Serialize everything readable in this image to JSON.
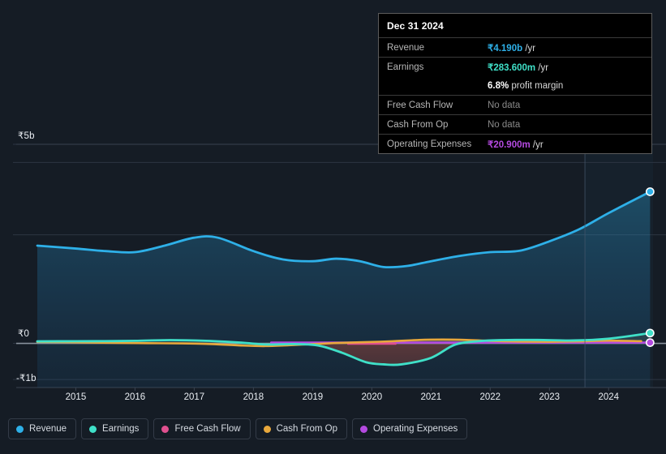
{
  "chart_data": {
    "type": "area",
    "title": "",
    "xlabel": "",
    "ylabel": "",
    "currency": "₹",
    "ylim": [
      -1000000000,
      5000000000
    ],
    "y_ticks": [
      {
        "label": "₹5b",
        "value": 5000000000
      },
      {
        "label": "₹0",
        "value": 0
      },
      {
        "label": "-₹1b",
        "value": -1000000000
      }
    ],
    "x_ticks": [
      "2015",
      "2016",
      "2017",
      "2018",
      "2019",
      "2020",
      "2021",
      "2022",
      "2023",
      "2024"
    ],
    "grid": true,
    "legend_position": "bottom",
    "forecast_divider_year": 2023.6,
    "series": [
      {
        "name": "Revenue",
        "color": "#2eb0e8",
        "x": [
          2014.35,
          2015.0,
          2015.5,
          2016.0,
          2016.5,
          2017.0,
          2017.4,
          2018.0,
          2018.5,
          2019.0,
          2019.4,
          2019.8,
          2020.2,
          2020.6,
          2021.0,
          2021.5,
          2022.0,
          2022.5,
          2023.0,
          2023.5,
          2024.0,
          2024.7
        ],
        "values": [
          2.7,
          2.62,
          2.55,
          2.52,
          2.7,
          2.92,
          2.92,
          2.55,
          2.32,
          2.27,
          2.34,
          2.27,
          2.11,
          2.14,
          2.27,
          2.42,
          2.52,
          2.56,
          2.82,
          3.15,
          3.6,
          4.19
        ],
        "units": "b"
      },
      {
        "name": "Earnings",
        "color": "#3fe0c8",
        "x": [
          2014.35,
          2015.0,
          2015.5,
          2016.0,
          2016.6,
          2017.2,
          2017.8,
          2018.2,
          2018.7,
          2019.1,
          2019.5,
          2019.9,
          2020.2,
          2020.5,
          2021.0,
          2021.4,
          2021.8,
          2022.2,
          2022.8,
          2023.4,
          2024.0,
          2024.7
        ],
        "values": [
          0.055,
          0.06,
          0.062,
          0.07,
          0.09,
          0.07,
          0.02,
          -0.03,
          -0.02,
          -0.06,
          -0.26,
          -0.52,
          -0.58,
          -0.58,
          -0.4,
          -0.04,
          0.06,
          0.09,
          0.095,
          0.08,
          0.13,
          0.284
        ],
        "units": "b"
      },
      {
        "name": "Free Cash Flow",
        "color": "#e0508f",
        "x": [
          2019.6,
          2020.0,
          2020.4
        ],
        "values": [
          -0.01,
          -0.01,
          -0.01
        ],
        "units": "b"
      },
      {
        "name": "Cash From Op",
        "color": "#e8a83c",
        "x": [
          2014.35,
          2015.0,
          2015.6,
          2016.2,
          2016.8,
          2017.3,
          2017.8,
          2018.2,
          2018.6,
          2019.0,
          2019.4,
          2019.8,
          2020.3,
          2020.8,
          2021.2,
          2021.6,
          2022.0,
          2022.5,
          2023.0,
          2023.5,
          2024.0,
          2024.55
        ],
        "values": [
          0.04,
          0.03,
          0.015,
          0.005,
          0.0,
          -0.02,
          -0.06,
          -0.075,
          -0.05,
          -0.02,
          0.01,
          0.03,
          0.055,
          0.095,
          0.105,
          0.095,
          0.07,
          0.05,
          0.045,
          0.055,
          0.075,
          0.06
        ],
        "units": "b"
      },
      {
        "name": "Operating Expenses",
        "color": "#b44ae0",
        "x": [
          2018.3,
          2019.0,
          2020.0,
          2021.0,
          2022.0,
          2023.0,
          2024.0,
          2024.7
        ],
        "values": [
          0.021,
          0.021,
          0.021,
          0.021,
          0.021,
          0.021,
          0.021,
          0.021
        ],
        "units": "b"
      }
    ]
  },
  "tooltip": {
    "date": "Dec 31 2024",
    "rows": [
      {
        "key": "Revenue",
        "value": "₹4.190b",
        "unit": " /yr",
        "color": "#2eb0e8",
        "nodata": false
      },
      {
        "key": "Earnings",
        "value": "₹283.600m",
        "unit": " /yr",
        "color": "#3fe0c8",
        "nodata": false
      },
      {
        "key": "",
        "value": "6.8%",
        "unit": " profit margin",
        "color": "#ffffff",
        "nodata": false,
        "sub": true
      },
      {
        "key": "Free Cash Flow",
        "value": "No data",
        "unit": "",
        "color": "#8a8a8a",
        "nodata": true
      },
      {
        "key": "Cash From Op",
        "value": "No data",
        "unit": "",
        "color": "#8a8a8a",
        "nodata": true
      },
      {
        "key": "Operating Expenses",
        "value": "₹20.900m",
        "unit": " /yr",
        "color": "#b44ae0",
        "nodata": false
      }
    ]
  },
  "legend": {
    "items": [
      {
        "label": "Revenue",
        "color": "#2eb0e8"
      },
      {
        "label": "Earnings",
        "color": "#3fe0c8"
      },
      {
        "label": "Free Cash Flow",
        "color": "#e0508f"
      },
      {
        "label": "Cash From Op",
        "color": "#e8a83c"
      },
      {
        "label": "Operating Expenses",
        "color": "#b44ae0"
      }
    ]
  },
  "colors": {
    "background": "#151c25",
    "grid": "#2c3542",
    "zero_line": "#9aa3ad",
    "axis_text": "#e9edf2"
  }
}
